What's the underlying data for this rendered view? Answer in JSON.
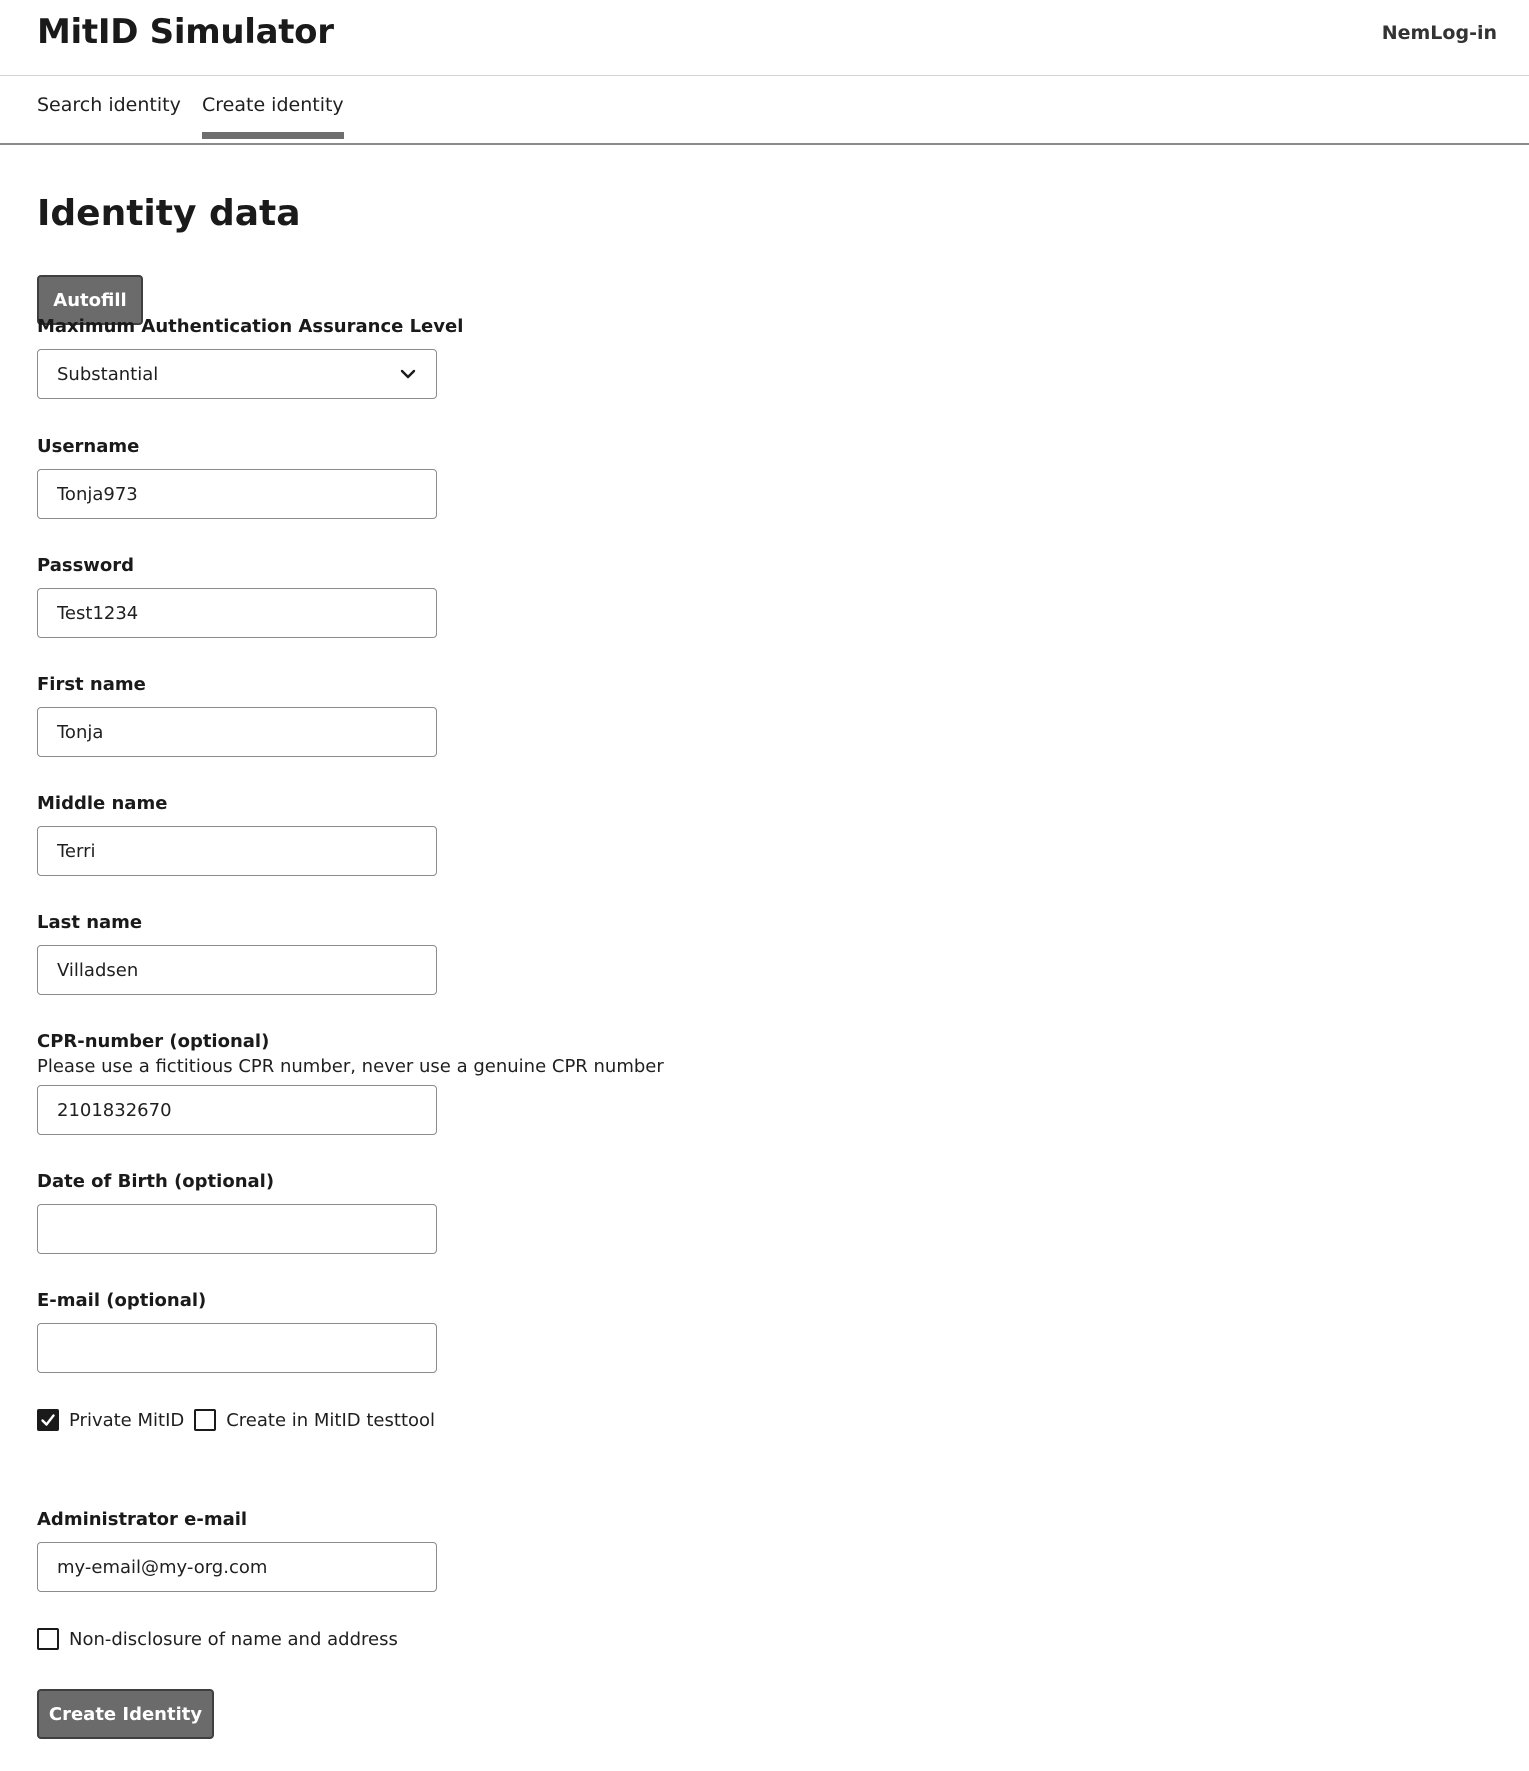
{
  "header": {
    "title": "MitID Simulator",
    "nemlogin_link": "NemLog-in"
  },
  "tabs": [
    {
      "label": "Search identity",
      "active": false
    },
    {
      "label": "Create identity",
      "active": true
    }
  ],
  "form": {
    "title": "Identity data",
    "autofill_label": "Autofill",
    "assurance": {
      "label": "Maximum Authentication Assurance Level",
      "value": "Substantial"
    },
    "username": {
      "label": "Username",
      "value": "Tonja973"
    },
    "password": {
      "label": "Password",
      "value": "Test1234"
    },
    "first_name": {
      "label": "First name",
      "value": "Tonja"
    },
    "middle_name": {
      "label": "Middle name",
      "value": "Terri"
    },
    "last_name": {
      "label": "Last name",
      "value": "Villadsen"
    },
    "cpr": {
      "label": "CPR-number (optional)",
      "hint": "Please use a fictitious CPR number, never use a genuine CPR number",
      "value": "2101832670"
    },
    "dob": {
      "label": "Date of Birth (optional)",
      "value": ""
    },
    "email": {
      "label": "E-mail (optional)",
      "value": ""
    },
    "private_mitid": {
      "label": "Private MitID",
      "checked": true
    },
    "create_testtool": {
      "label": "Create in MitID testtool",
      "checked": false
    },
    "admin_email": {
      "label": "Administrator e-mail",
      "value": "my-email@my-org.com"
    },
    "non_disclosure": {
      "label": "Non-disclosure of name and address",
      "checked": false
    },
    "submit_label": "Create Identity"
  },
  "colors": {
    "button_bg": "#6b6b6b",
    "tab_indicator": "#6e6e6e",
    "checkbox_checked": "#1a1a1a"
  }
}
